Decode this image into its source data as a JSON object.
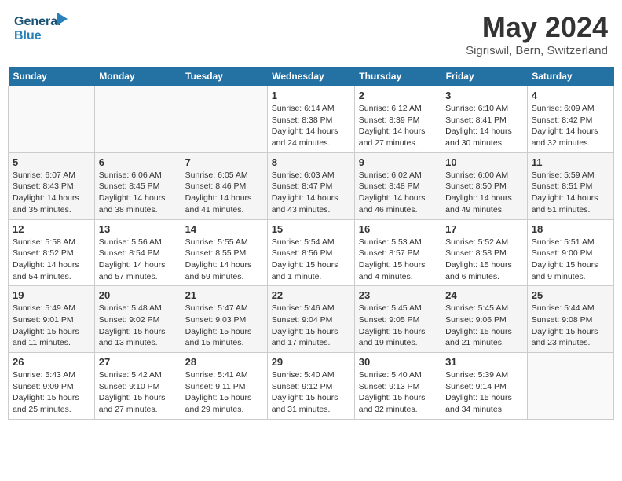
{
  "header": {
    "logo_line1": "General",
    "logo_line2": "Blue",
    "month_year": "May 2024",
    "location": "Sigriswil, Bern, Switzerland"
  },
  "weekdays": [
    "Sunday",
    "Monday",
    "Tuesday",
    "Wednesday",
    "Thursday",
    "Friday",
    "Saturday"
  ],
  "weeks": [
    [
      {
        "day": "",
        "info": ""
      },
      {
        "day": "",
        "info": ""
      },
      {
        "day": "",
        "info": ""
      },
      {
        "day": "1",
        "info": "Sunrise: 6:14 AM\nSunset: 8:38 PM\nDaylight: 14 hours\nand 24 minutes."
      },
      {
        "day": "2",
        "info": "Sunrise: 6:12 AM\nSunset: 8:39 PM\nDaylight: 14 hours\nand 27 minutes."
      },
      {
        "day": "3",
        "info": "Sunrise: 6:10 AM\nSunset: 8:41 PM\nDaylight: 14 hours\nand 30 minutes."
      },
      {
        "day": "4",
        "info": "Sunrise: 6:09 AM\nSunset: 8:42 PM\nDaylight: 14 hours\nand 32 minutes."
      }
    ],
    [
      {
        "day": "5",
        "info": "Sunrise: 6:07 AM\nSunset: 8:43 PM\nDaylight: 14 hours\nand 35 minutes."
      },
      {
        "day": "6",
        "info": "Sunrise: 6:06 AM\nSunset: 8:45 PM\nDaylight: 14 hours\nand 38 minutes."
      },
      {
        "day": "7",
        "info": "Sunrise: 6:05 AM\nSunset: 8:46 PM\nDaylight: 14 hours\nand 41 minutes."
      },
      {
        "day": "8",
        "info": "Sunrise: 6:03 AM\nSunset: 8:47 PM\nDaylight: 14 hours\nand 43 minutes."
      },
      {
        "day": "9",
        "info": "Sunrise: 6:02 AM\nSunset: 8:48 PM\nDaylight: 14 hours\nand 46 minutes."
      },
      {
        "day": "10",
        "info": "Sunrise: 6:00 AM\nSunset: 8:50 PM\nDaylight: 14 hours\nand 49 minutes."
      },
      {
        "day": "11",
        "info": "Sunrise: 5:59 AM\nSunset: 8:51 PM\nDaylight: 14 hours\nand 51 minutes."
      }
    ],
    [
      {
        "day": "12",
        "info": "Sunrise: 5:58 AM\nSunset: 8:52 PM\nDaylight: 14 hours\nand 54 minutes."
      },
      {
        "day": "13",
        "info": "Sunrise: 5:56 AM\nSunset: 8:54 PM\nDaylight: 14 hours\nand 57 minutes."
      },
      {
        "day": "14",
        "info": "Sunrise: 5:55 AM\nSunset: 8:55 PM\nDaylight: 14 hours\nand 59 minutes."
      },
      {
        "day": "15",
        "info": "Sunrise: 5:54 AM\nSunset: 8:56 PM\nDaylight: 15 hours\nand 1 minute."
      },
      {
        "day": "16",
        "info": "Sunrise: 5:53 AM\nSunset: 8:57 PM\nDaylight: 15 hours\nand 4 minutes."
      },
      {
        "day": "17",
        "info": "Sunrise: 5:52 AM\nSunset: 8:58 PM\nDaylight: 15 hours\nand 6 minutes."
      },
      {
        "day": "18",
        "info": "Sunrise: 5:51 AM\nSunset: 9:00 PM\nDaylight: 15 hours\nand 9 minutes."
      }
    ],
    [
      {
        "day": "19",
        "info": "Sunrise: 5:49 AM\nSunset: 9:01 PM\nDaylight: 15 hours\nand 11 minutes."
      },
      {
        "day": "20",
        "info": "Sunrise: 5:48 AM\nSunset: 9:02 PM\nDaylight: 15 hours\nand 13 minutes."
      },
      {
        "day": "21",
        "info": "Sunrise: 5:47 AM\nSunset: 9:03 PM\nDaylight: 15 hours\nand 15 minutes."
      },
      {
        "day": "22",
        "info": "Sunrise: 5:46 AM\nSunset: 9:04 PM\nDaylight: 15 hours\nand 17 minutes."
      },
      {
        "day": "23",
        "info": "Sunrise: 5:45 AM\nSunset: 9:05 PM\nDaylight: 15 hours\nand 19 minutes."
      },
      {
        "day": "24",
        "info": "Sunrise: 5:45 AM\nSunset: 9:06 PM\nDaylight: 15 hours\nand 21 minutes."
      },
      {
        "day": "25",
        "info": "Sunrise: 5:44 AM\nSunset: 9:08 PM\nDaylight: 15 hours\nand 23 minutes."
      }
    ],
    [
      {
        "day": "26",
        "info": "Sunrise: 5:43 AM\nSunset: 9:09 PM\nDaylight: 15 hours\nand 25 minutes."
      },
      {
        "day": "27",
        "info": "Sunrise: 5:42 AM\nSunset: 9:10 PM\nDaylight: 15 hours\nand 27 minutes."
      },
      {
        "day": "28",
        "info": "Sunrise: 5:41 AM\nSunset: 9:11 PM\nDaylight: 15 hours\nand 29 minutes."
      },
      {
        "day": "29",
        "info": "Sunrise: 5:40 AM\nSunset: 9:12 PM\nDaylight: 15 hours\nand 31 minutes."
      },
      {
        "day": "30",
        "info": "Sunrise: 5:40 AM\nSunset: 9:13 PM\nDaylight: 15 hours\nand 32 minutes."
      },
      {
        "day": "31",
        "info": "Sunrise: 5:39 AM\nSunset: 9:14 PM\nDaylight: 15 hours\nand 34 minutes."
      },
      {
        "day": "",
        "info": ""
      }
    ]
  ]
}
